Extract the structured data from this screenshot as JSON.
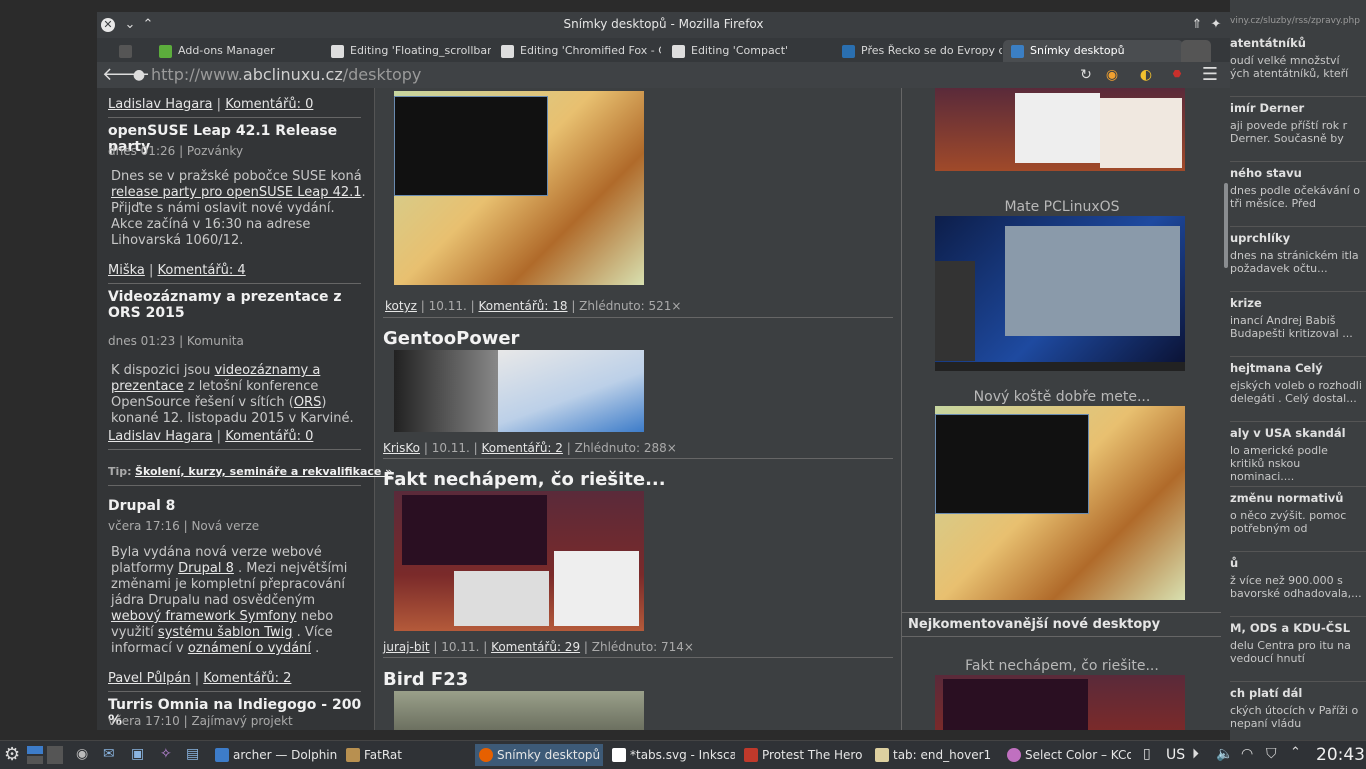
{
  "window": {
    "title": "Snímky desktopů - Mozilla Firefox"
  },
  "tabs": [
    {
      "label": "Add-ons Manager",
      "icon": "puzzle-icon"
    },
    {
      "label": "Editing 'Floating_scrollbars'",
      "icon": "s-icon"
    },
    {
      "label": "Editing 'Chromified Fox - C...",
      "icon": "s-icon"
    },
    {
      "label": "Editing 'Compact'",
      "icon": "s-icon"
    },
    {
      "label": "Přes Řecko se do Evropy do...",
      "icon": "ctk-icon"
    },
    {
      "label": "Snímky desktopů",
      "icon": "abclinuxu-icon"
    }
  ],
  "url": {
    "prefix": "http://www.",
    "domain": "abclinuxu.cz",
    "path": "/desktopy"
  },
  "left": {
    "top_author": "Ladislav Hagara",
    "top_comments": "Komentářů: 0",
    "news": [
      {
        "title": "openSUSE Leap 42.1 Release party",
        "meta": "dnes 01:26 | Pozvánky",
        "p1": "Dnes se v pražské pobočce SUSE koná",
        "link1": "release party pro openSUSE Leap 42.1",
        "p2": ". Přijďte s námi oslavit nové vydání. Akce začíná v 16:30 na adrese Lihovarská 1060/12.",
        "author": "Miška",
        "comments": "Komentářů: 4"
      },
      {
        "title": "Videozáznamy a prezentace z ORS 2015",
        "meta": "dnes 01:23 | Komunita",
        "p1": "K dispozici jsou",
        "link1": "videozáznamy a prezentace",
        "p2": "z letošní konference OpenSource řešení v sítích (",
        "link2": "ORS",
        "p3": ") konané 12. listopadu 2015 v Karviné.",
        "author": "Ladislav Hagara",
        "comments": "Komentářů: 0"
      },
      {
        "title": "Drupal 8",
        "meta": "včera 17:16 | Nová verze",
        "p1": "Byla vydána nová verze webové platformy",
        "link1": "Drupal 8",
        "p2": ". Mezi největšími změnami je kompletní přepracování jádra Drupalu nad osvědčeným",
        "link2": "webový framework Symfony",
        "p3": "nebo využití",
        "link3": "systému šablon Twig",
        "p4": ". Více informací v",
        "link4": "oznámení o vydání",
        "p5": ".",
        "author": "Pavel Půlpán",
        "comments": "Komentářů: 2"
      },
      {
        "title": "Turris Omnia na Indiegogo - 200 %",
        "meta": "včera 17:10 | Zajímavý projekt"
      }
    ],
    "tip_label": "Tip:",
    "tip_link": "Školení, kurzy, semináře a rekvalifikace »"
  },
  "middle": {
    "items": [
      {
        "author": "kotyz",
        "date": "10.11.",
        "comments": "Komentářů: 18",
        "views": "Zhlédnuto: 521×"
      },
      {
        "title": "GentooPower",
        "author": "KrisKo",
        "date": "10.11.",
        "comments": "Komentářů: 2",
        "views": "Zhlédnuto: 288×"
      },
      {
        "title": "Fakt nechápem, čo riešite...",
        "author": "juraj-bit",
        "date": "10.11.",
        "comments": "Komentářů: 29",
        "views": "Zhlédnuto: 714×"
      },
      {
        "title": "Bird F23"
      }
    ]
  },
  "right": {
    "captions": [
      "Mate PCLinuxOS",
      "Nový koště dobře mete..."
    ],
    "section_header": "Nejkomentovanější nové desktopy",
    "section_caption": "Fakt nechápem, čo riešite..."
  },
  "strip": {
    "url": "viny.cz/sluzby/rss/zpravy.php",
    "items": [
      {
        "h": "atentátníků",
        "t": "oudí velké množství ých atentátníků, kteří"
      },
      {
        "h": "imír Derner",
        "t": "aji povede příští rok r Derner. Současně by"
      },
      {
        "h": "ného stavu",
        "t": "dnes podle očekávání o tři měsíce. Před"
      },
      {
        "h": "uprchlíky",
        "t": "dnes na stránickém itla požadavek očtu..."
      },
      {
        "h": "krize",
        "t": "inancí Andrej Babiš Budapešti kritizoval ..."
      },
      {
        "h": "hejtmana Celý",
        "t": "ejských voleb o rozhodli delegáti . Celý dostal..."
      },
      {
        "h": "aly v USA skandál",
        "t": "lo americké podle kritiků nskou nominaci...."
      },
      {
        "h": "změnu normativů",
        "t": "o něco zvýšit. pomoc potřebným od"
      },
      {
        "h": "ů",
        "t": "ž více než 900.000 s bavorské odhadovala,..."
      },
      {
        "h": "M, ODS a KDU-ČSL",
        "t": "delu Centra pro itu na vedoucí hnutí"
      },
      {
        "h": "ch platí dál",
        "t": "ckých útocích v Paříži o nepaní vládu"
      }
    ]
  },
  "taskbar": {
    "tasks": [
      {
        "label": "archer — Dolphin"
      },
      {
        "label": "FatRat"
      },
      {
        "label": "Snímky desktopů"
      },
      {
        "label": "*tabs.svg - Inkscap"
      },
      {
        "label": "Protest The Hero"
      },
      {
        "label": "tab: end_hover1"
      },
      {
        "label": "Select Color – KCo"
      }
    ],
    "keyboard": "US",
    "clock": "20:43"
  },
  "colors": {
    "accent": "#3d5a77",
    "link": "#e6e6e6"
  }
}
